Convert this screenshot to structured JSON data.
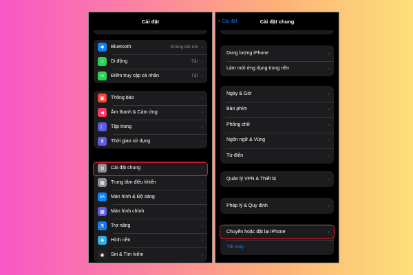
{
  "left": {
    "title": "Cài đặt",
    "group1": [
      {
        "label": "Bluetooth",
        "value": "Không kết nối",
        "icon": "bluetooth-icon",
        "color": "#0a84ff",
        "glyph": "✱"
      },
      {
        "label": "Di động",
        "value": "Tắt",
        "icon": "cellular-icon",
        "color": "#30d158",
        "glyph": "ıl"
      },
      {
        "label": "Điểm truy cập cá nhân",
        "value": "Tắt",
        "icon": "hotspot-icon",
        "color": "#30d158",
        "glyph": "∞"
      }
    ],
    "group2": [
      {
        "label": "Thông báo",
        "icon": "notifications-icon",
        "color": "#ff453a",
        "glyph": "▣"
      },
      {
        "label": "Âm thanh & Cảm ứng",
        "icon": "sounds-icon",
        "color": "#ff375f",
        "glyph": "◀"
      },
      {
        "label": "Tập trung",
        "icon": "focus-icon",
        "color": "#5e5ce6",
        "glyph": "☾"
      },
      {
        "label": "Thời gian sử dụng",
        "icon": "screen-time-icon",
        "color": "#5e5ce6",
        "glyph": "⧗"
      }
    ],
    "group3": [
      {
        "label": "Cài đặt chung",
        "icon": "general-gear-icon",
        "color": "#8e8e93",
        "glyph": "⚙"
      },
      {
        "label": "Trung tâm điều khiển",
        "icon": "control-center-icon",
        "color": "#8e8e93",
        "glyph": "▦"
      },
      {
        "label": "Màn hình & Độ sáng",
        "icon": "display-icon",
        "color": "#0a84ff",
        "glyph": "AA"
      },
      {
        "label": "Màn hình chính",
        "icon": "home-screen-icon",
        "color": "#5e5ce6",
        "glyph": "▦"
      },
      {
        "label": "Trợ năng",
        "icon": "accessibility-icon",
        "color": "#0a84ff",
        "glyph": "♿"
      },
      {
        "label": "Hình nền",
        "icon": "wallpaper-icon",
        "color": "#32ade6",
        "glyph": "❋"
      },
      {
        "label": "Siri & Tìm kiếm",
        "icon": "siri-icon",
        "color": "#222222",
        "glyph": "◉"
      }
    ]
  },
  "right": {
    "title": "Cài đặt chung",
    "back_label": "Cài đặt",
    "group1": [
      {
        "label": "Dung lượng iPhone"
      },
      {
        "label": "Làm mới ứng dụng trong nền"
      }
    ],
    "group2": [
      {
        "label": "Ngày & Giờ"
      },
      {
        "label": "Bàn phím"
      },
      {
        "label": "Phông chữ"
      },
      {
        "label": "Ngôn ngữ & Vùng"
      },
      {
        "label": "Từ điển"
      }
    ],
    "group3": [
      {
        "label": "Quản lý VPN & Thiết bị"
      }
    ],
    "group4": [
      {
        "label": "Pháp lý & Quy định"
      }
    ],
    "group5": [
      {
        "label": "Chuyển hoặc đặt lại iPhone"
      },
      {
        "label": "Tắt máy"
      }
    ]
  },
  "colors": {
    "highlight": "#e0182a",
    "link": "#0a84ff",
    "cell_bg": "#1c1c1e"
  }
}
